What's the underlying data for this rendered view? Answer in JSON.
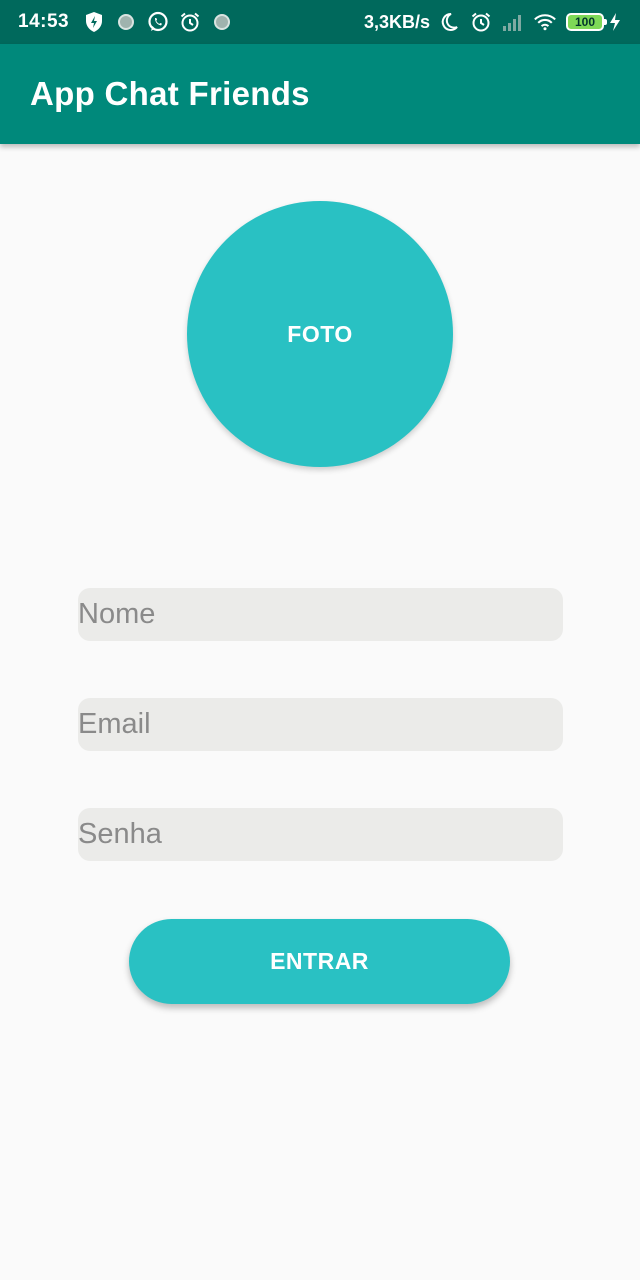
{
  "status_bar": {
    "time": "14:53",
    "network_speed": "3,3KB/s",
    "battery_level": "100",
    "icons_left": [
      "shield-bolt-icon",
      "notification-dot-icon",
      "whatsapp-icon",
      "alarm-icon",
      "notification-dot-icon"
    ],
    "icons_right": [
      "moon-icon",
      "alarm-icon",
      "signal-icon",
      "wifi-icon",
      "battery-icon",
      "charging-icon"
    ]
  },
  "app_bar": {
    "title": "App Chat Friends",
    "color": "#00897b"
  },
  "photo_button": {
    "label": "FOTO",
    "color": "#29c1c3"
  },
  "form": {
    "name_placeholder": "Nome",
    "email_placeholder": "Email",
    "password_placeholder": "Senha",
    "field_color": "#ebebe9"
  },
  "enter_button": {
    "label": "ENTRAR",
    "color": "#29c1c3"
  }
}
